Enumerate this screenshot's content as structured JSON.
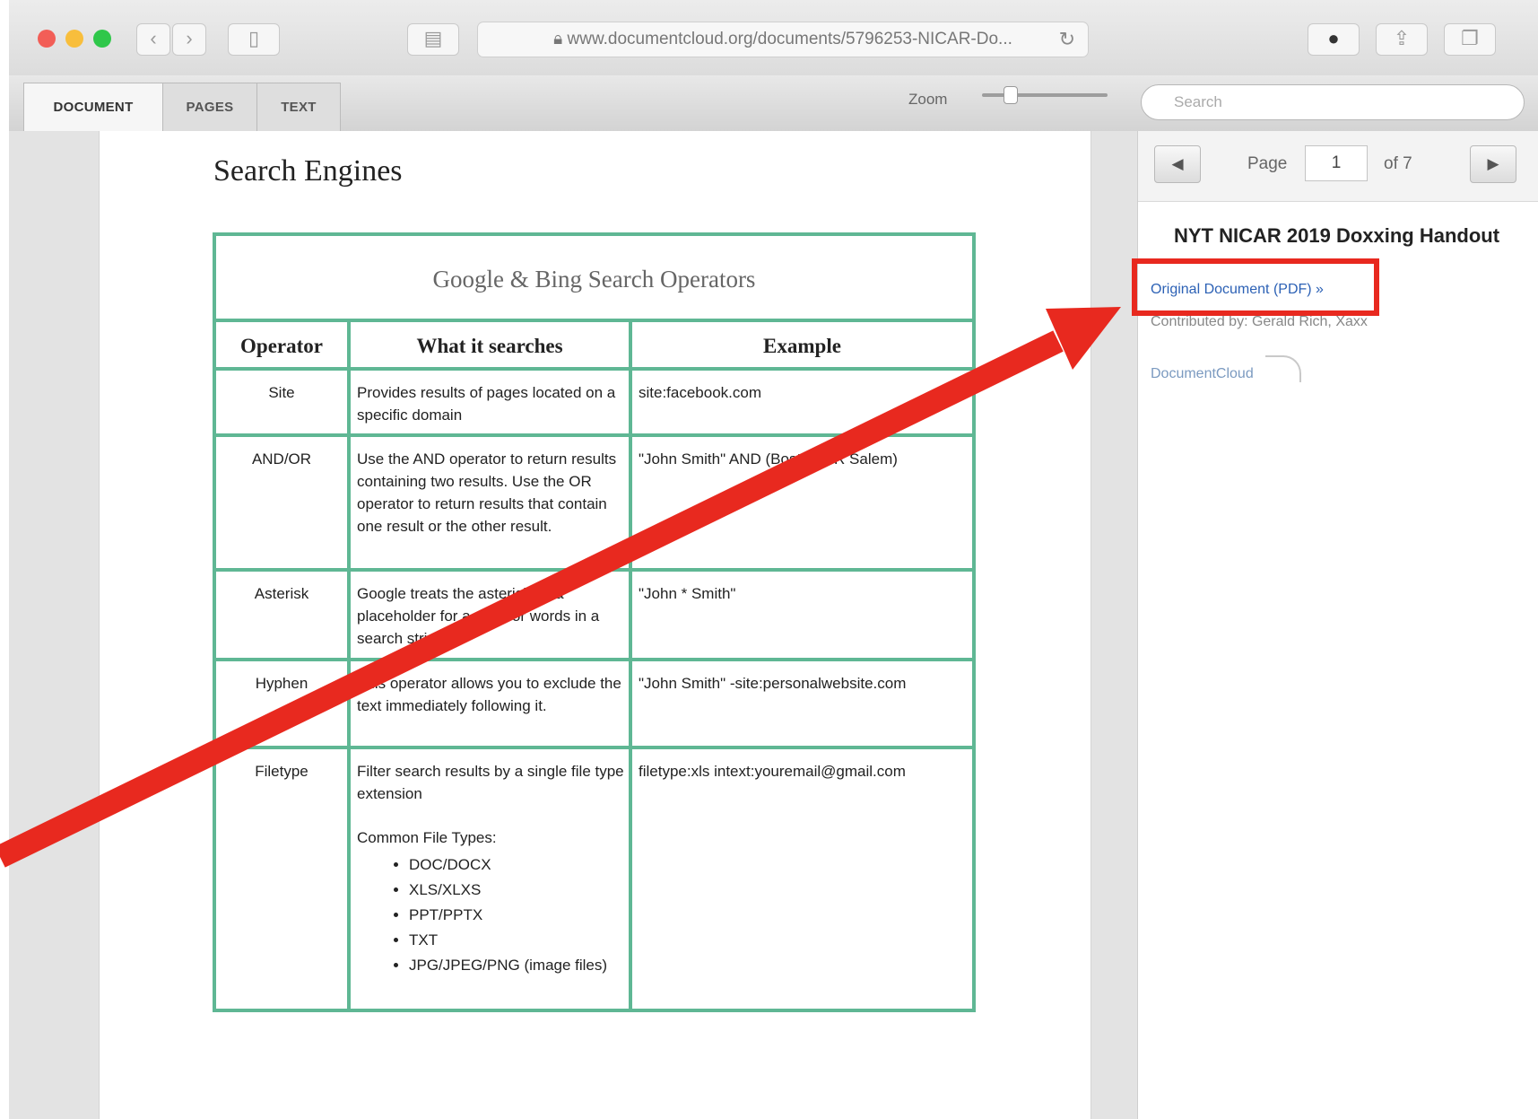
{
  "browser": {
    "url": "www.documentcloud.org/documents/5796253-NICAR-Do..."
  },
  "viewer": {
    "tabs": [
      "DOCUMENT",
      "PAGES",
      "TEXT"
    ],
    "zoom_label": "Zoom",
    "search_placeholder": "Search"
  },
  "document": {
    "page_heading": "Search Engines",
    "table_caption": "Google & Bing Search Operators",
    "columns": [
      "Operator",
      "What it searches",
      "Example"
    ],
    "rows": [
      {
        "operator": "Site",
        "searches": "Provides results of pages located on a specific domain",
        "example": "site:facebook.com"
      },
      {
        "operator": "AND/OR",
        "searches": "Use the AND operator to return results containing two results. Use the OR operator to return results that contain one result or the other result.",
        "example": "\"John Smith\" AND (Boston OR Salem)"
      },
      {
        "operator": "Asterisk",
        "searches": "Google treats the asterisk as a placeholder for a word or words in a search string.",
        "example": "\"John * Smith\""
      },
      {
        "operator": "Hyphen",
        "searches": "This operator allows you to exclude the text immediately following it.",
        "example": "\"John Smith\" -site:personalwebsite.com"
      },
      {
        "operator": "Filetype",
        "searches": "Filter search results by a single file type extension",
        "searches_sub": "Common File Types:",
        "file_types": [
          "DOC/DOCX",
          "XLS/XLXS",
          "PPT/PPTX",
          "TXT",
          "JPG/JPEG/PNG (image files)"
        ],
        "example": "filetype:xls intext:youremail@gmail.com"
      }
    ]
  },
  "sidebar": {
    "page_label": "Page",
    "page_current": "1",
    "page_of": "of 7",
    "doc_title": "NYT NICAR 2019 Doxxing Handout",
    "original_link": "Original Document (PDF) »",
    "contributed": "Contributed by: Gerald Rich, Xaxx",
    "logo_text": "DocumentCloud"
  },
  "annotation": {
    "color": "#e8291f"
  }
}
